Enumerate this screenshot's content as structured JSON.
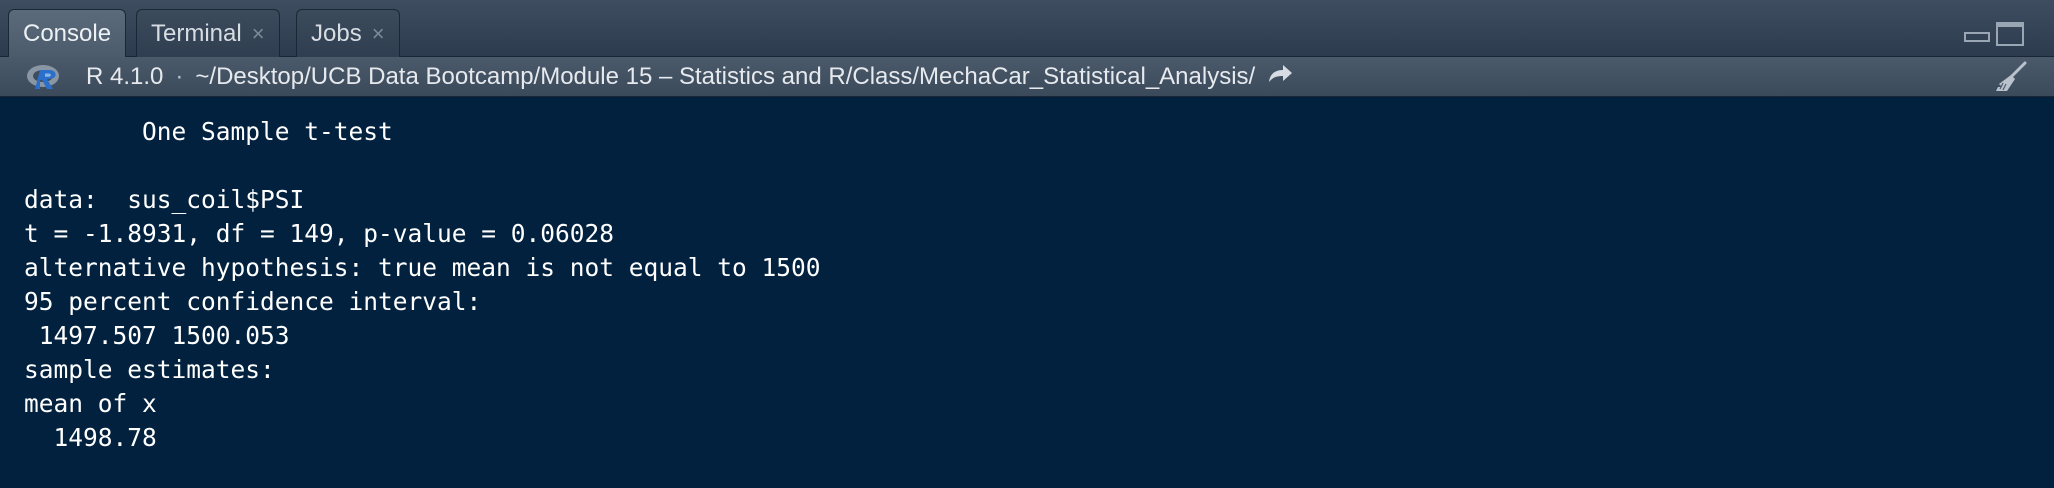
{
  "tabs": [
    {
      "label": "Console",
      "active": true,
      "closable": false
    },
    {
      "label": "Terminal",
      "active": false,
      "closable": true
    },
    {
      "label": "Jobs",
      "active": false,
      "closable": true
    }
  ],
  "tab_close_glyph": "×",
  "path_bar": {
    "icon": "r-logo-icon",
    "version": "R 4.1.0",
    "separator": "·",
    "path": "~/Desktop/UCB Data Bootcamp/Module 15 – Statistics and R/Class/MechaCar_Statistical_Analysis/",
    "go_icon": "go-to-directory-icon",
    "clear_icon": "broom-icon"
  },
  "console": {
    "lines": [
      "        One Sample t-test",
      "",
      "data:  sus_coil$PSI",
      "t = -1.8931, df = 149, p-value = 0.06028",
      "alternative hypothesis: true mean is not equal to 1500",
      "95 percent confidence interval:",
      " 1497.507 1500.053",
      "sample estimates:",
      "mean of x",
      "  1498.78"
    ]
  },
  "colors": {
    "console_bg": "#01213f",
    "console_text": "#ffffff",
    "tab_active": "#56667a",
    "accent_r": "#2a6fc9"
  }
}
